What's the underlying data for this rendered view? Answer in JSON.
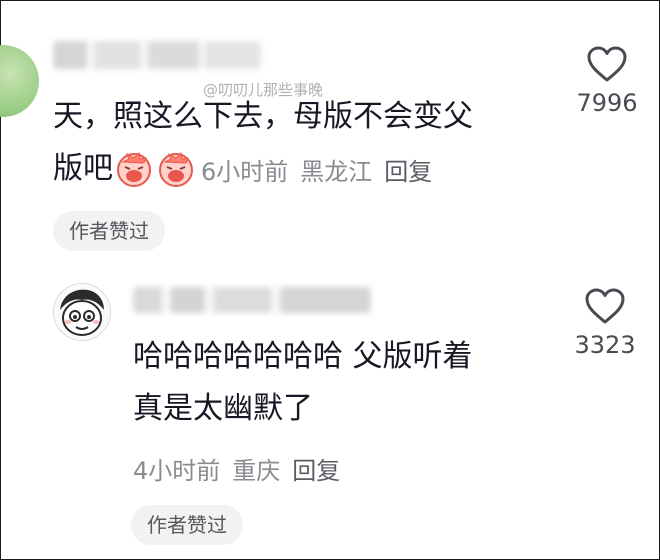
{
  "watermark": "@叨叨儿那些事晚",
  "comment1": {
    "username": "",
    "line1": "天，照这么下去，母版不会变父",
    "line2": "版吧",
    "emoji_icon": "crying-face-emoji",
    "time": "6小时前",
    "location": "黑龙江",
    "reply_label": "回复",
    "badge": "作者赞过",
    "like_icon": "heart-outline-icon",
    "like_count": "7996"
  },
  "comment2": {
    "username": "",
    "line1": "哈哈哈哈哈哈哈 父版听着",
    "line2": "真是太幽默了",
    "time": "4小时前",
    "location": "重庆",
    "reply_label": "回复",
    "badge": "作者赞过",
    "like_icon": "heart-outline-icon",
    "like_count": "3323"
  }
}
